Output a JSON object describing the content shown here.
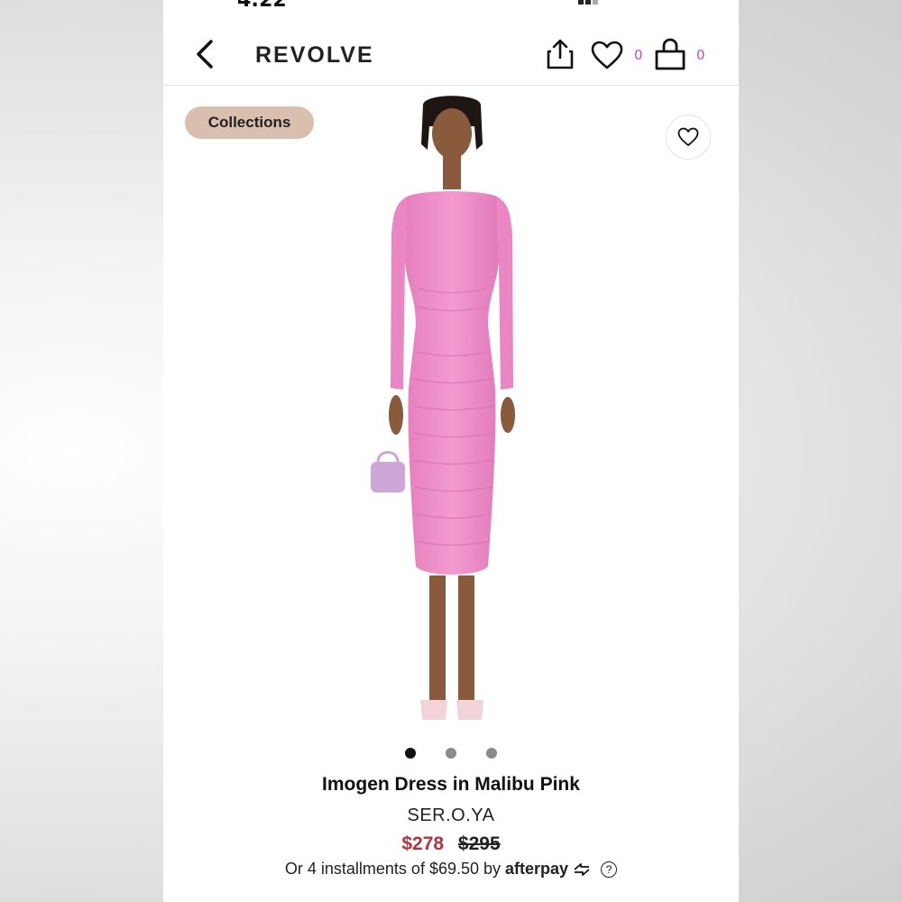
{
  "status_bar": {
    "time": "4:22"
  },
  "header": {
    "brand": "REVOLVE",
    "wishlist_count": "0",
    "bag_count": "0"
  },
  "badge": {
    "label": "Collections"
  },
  "gallery": {
    "image_count": 3,
    "active_index": 0
  },
  "product": {
    "name": "Imogen Dress in Malibu Pink",
    "designer": "SER.O.YA",
    "sale_price": "$278",
    "original_price": "$295",
    "installments_prefix": "Or 4 installments of $69.50 by",
    "afterpay_label": "afterpay",
    "help_glyph": "?"
  },
  "colors": {
    "dress": "#f08fc9",
    "badge": "#d8bfae",
    "sale": "#b3333a",
    "count": "#c04fb0"
  },
  "icons": [
    "back-arrow-icon",
    "share-icon",
    "heart-icon",
    "bag-icon",
    "heart-outline-icon",
    "afterpay-arrows-icon",
    "help-icon"
  ]
}
